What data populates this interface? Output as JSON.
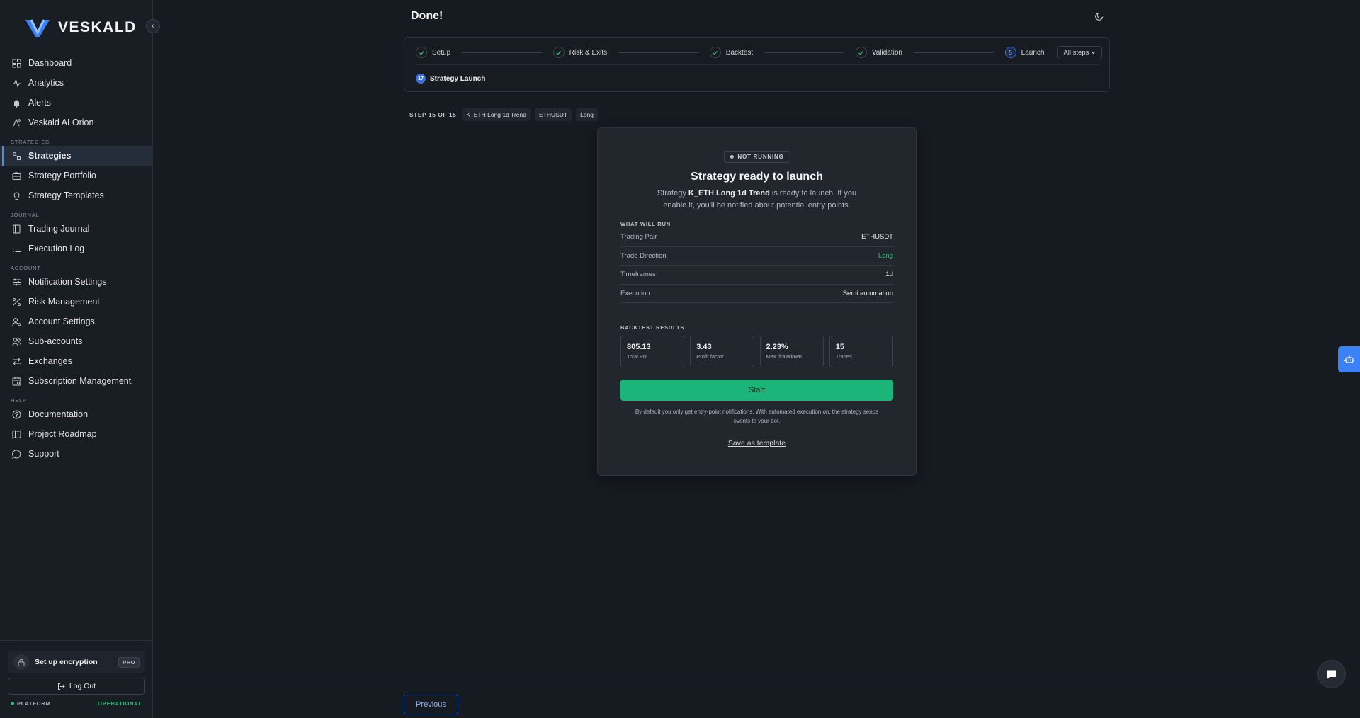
{
  "app": {
    "logo_text": "VESKALD",
    "brand_color": "#3b82f6",
    "success_color": "#22c07d"
  },
  "sidebar": {
    "primary": [
      {
        "label": "Dashboard",
        "icon": "dashboard-icon"
      },
      {
        "label": "Analytics",
        "icon": "analytics-icon"
      },
      {
        "label": "Alerts",
        "icon": "bell-icon"
      },
      {
        "label": "Veskald AI Orion",
        "icon": "ai-icon"
      }
    ],
    "sections": [
      {
        "title": "STRATEGIES",
        "items": [
          {
            "label": "Strategies",
            "icon": "strategies-icon",
            "active": true
          },
          {
            "label": "Strategy Portfolio",
            "icon": "briefcase-icon"
          },
          {
            "label": "Strategy Templates",
            "icon": "lightbulb-icon"
          }
        ]
      },
      {
        "title": "JOURNAL",
        "items": [
          {
            "label": "Trading Journal",
            "icon": "book-icon"
          },
          {
            "label": "Execution Log",
            "icon": "list-icon"
          }
        ]
      },
      {
        "title": "ACCOUNT",
        "items": [
          {
            "label": "Notification Settings",
            "icon": "sliders-icon"
          },
          {
            "label": "Risk Management",
            "icon": "percent-icon"
          },
          {
            "label": "Account Settings",
            "icon": "user-gear-icon"
          },
          {
            "label": "Sub-accounts",
            "icon": "users-icon"
          },
          {
            "label": "Exchanges",
            "icon": "swap-icon"
          },
          {
            "label": "Subscription Management",
            "icon": "calendar-icon"
          }
        ]
      },
      {
        "title": "HELP",
        "items": [
          {
            "label": "Documentation",
            "icon": "help-circle-icon"
          },
          {
            "label": "Project Roadmap",
            "icon": "map-icon"
          },
          {
            "label": "Support",
            "icon": "message-circle-icon"
          }
        ]
      }
    ],
    "encryption_label": "Set up encryption",
    "pro_badge": "PRO",
    "logout_label": "Log Out",
    "platform_label": "PLATFORM",
    "platform_status": "OPERATIONAL"
  },
  "header": {
    "title": "Done!"
  },
  "stepper": {
    "steps": [
      {
        "label": "Setup",
        "done": true
      },
      {
        "label": "Risk & Exits",
        "done": true
      },
      {
        "label": "Backtest",
        "done": true
      },
      {
        "label": "Validation",
        "done": true
      },
      {
        "label": "Launch",
        "done": false,
        "number": "5"
      }
    ],
    "all_steps_label": "All steps",
    "substep_number": "17",
    "substep_label": "Strategy Launch"
  },
  "step_info": {
    "label": "STEP 15 OF 15",
    "chips": [
      "K_ETH Long 1d Trend",
      "ETHUSDT",
      "Long"
    ]
  },
  "card": {
    "status": "NOT RUNNING",
    "title": "Strategy ready to launch",
    "desc_prefix": "Strategy ",
    "strategy_name": "K_ETH Long 1d Trend",
    "desc_suffix": " is ready to launch. If you enable it, you'll be notified about potential entry points.",
    "what_will_run_label": "WHAT WILL RUN",
    "rows": [
      {
        "key": "Trading Pair",
        "value": "ETHUSDT"
      },
      {
        "key": "Trade Direction",
        "value": "Long",
        "green": true
      },
      {
        "key": "Timeframes",
        "value": "1d"
      },
      {
        "key": "Execution",
        "value": "Semi automation"
      }
    ],
    "backtest_label": "BACKTEST RESULTS",
    "metrics": [
      {
        "value": "805.13",
        "label": "Total PnL"
      },
      {
        "value": "3.43",
        "label": "Profit factor"
      },
      {
        "value": "2.23%",
        "label": "Max drawdown"
      },
      {
        "value": "15",
        "label": "Trades"
      }
    ],
    "start_label": "Start",
    "note": "By default you only get entry-point notifications. With automated execution on, the strategy sends events to your bot.",
    "template_link": "Save as template"
  },
  "footer": {
    "previous_label": "Previous"
  }
}
